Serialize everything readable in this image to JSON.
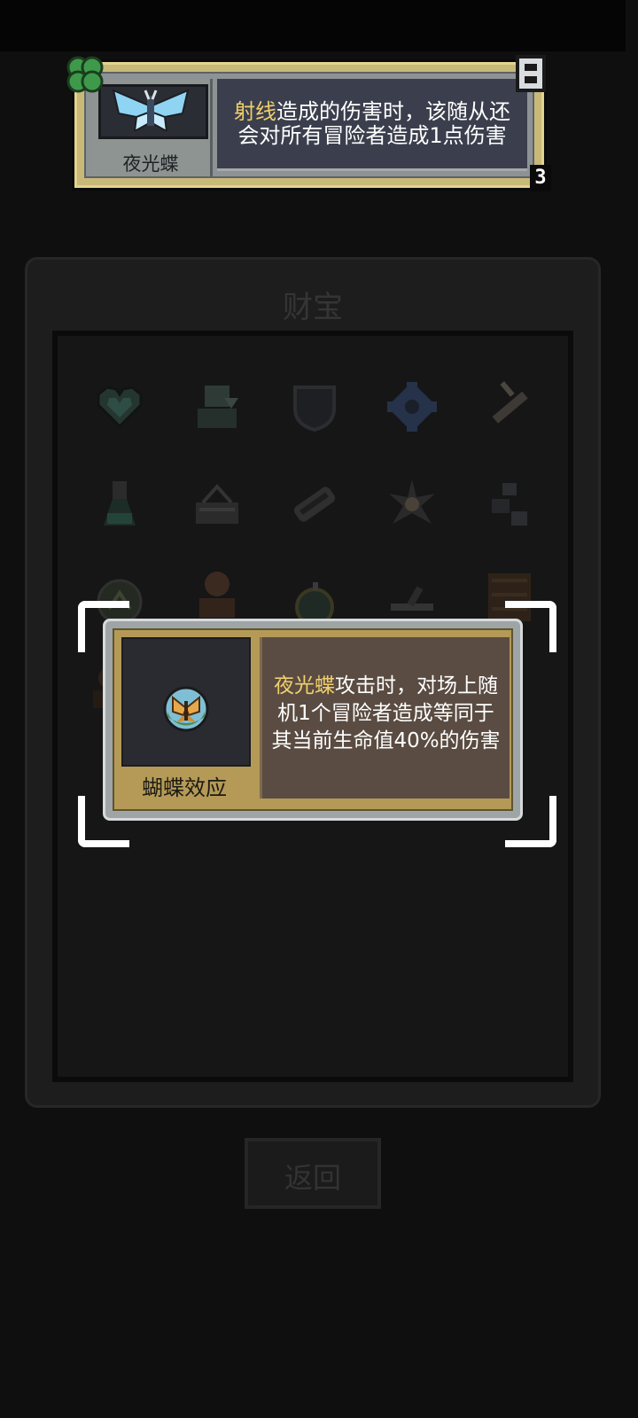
{
  "companion_card": {
    "name": "夜光蝶",
    "desc_highlight": "射线",
    "desc_rest": "造成的伤害时，该随从还会对所有冒险者造成1点伤害",
    "level": "3",
    "portrait_icon": "glow-butterfly-icon",
    "corner_icons": [
      "clover-icon",
      "plug-icon"
    ]
  },
  "panel": {
    "title": "财宝",
    "relic_icons": [
      "heart-gem-icon",
      "adventurer-bust-icon",
      "shield-icon",
      "cog-flower-icon",
      "syringe-icon",
      "potion-flask-icon",
      "basket-icon",
      "scroll-icon",
      "starburst-icon",
      "robot-icon",
      "orb-icon",
      "knight-bust-icon",
      "bomb-icon",
      "sword-icon",
      "bookcase-icon",
      "knight-bust-icon"
    ]
  },
  "effect_card": {
    "name": "蝴蝶效应",
    "desc_highlight": "夜光蝶",
    "desc_rest": "攻击时，对场上随机1个冒险者造成等同于其当前生命值40%的伤害",
    "icon": "butterfly-orb-icon"
  },
  "back_button": {
    "label": "返回"
  },
  "colors": {
    "highlight": "#f0cf6c",
    "background": "#0f0f0f",
    "card_gold": "#b49a56"
  }
}
